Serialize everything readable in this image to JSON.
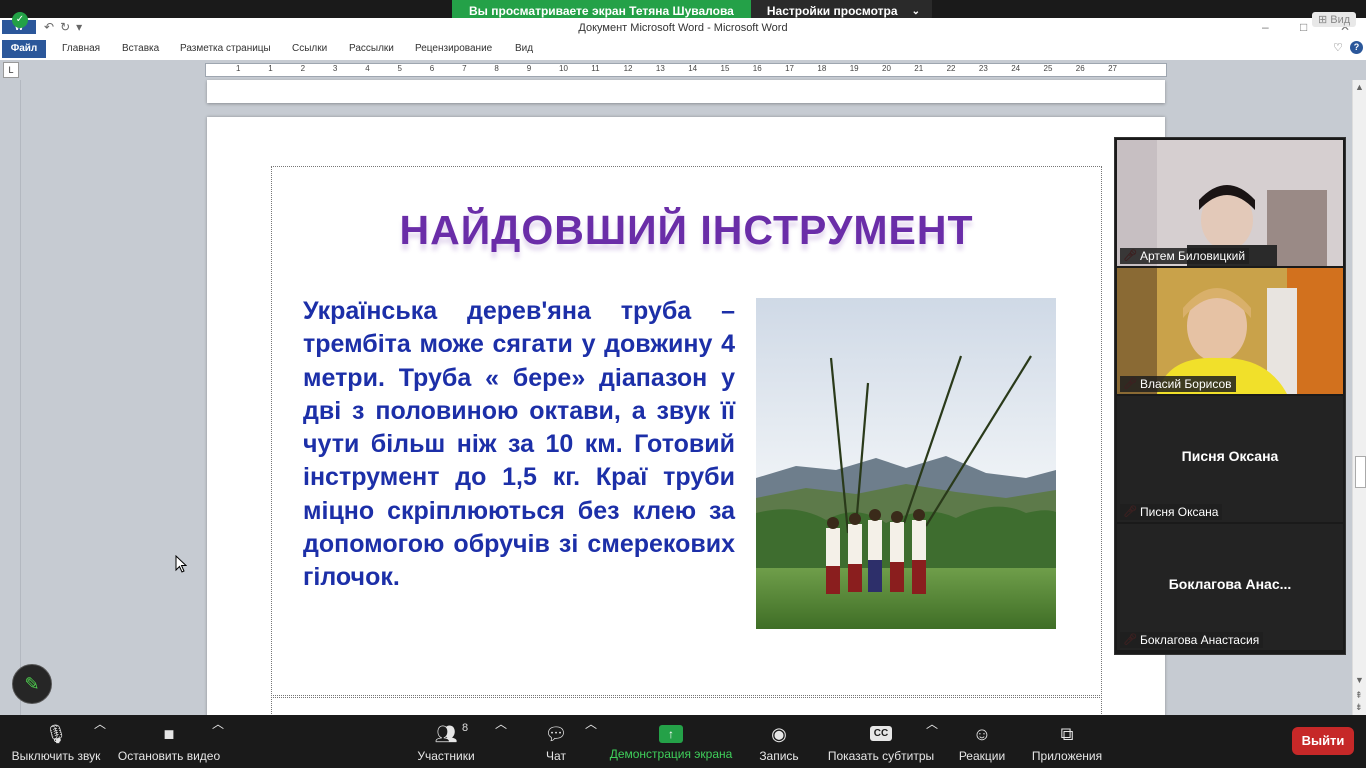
{
  "zoom": {
    "banner": {
      "sharing_text": "Вы просматриваете экран Тетяна Шувалова",
      "view_options": "Настройки просмотра"
    },
    "view_button": "Вид",
    "participants": [
      {
        "label": "Артем Биловицкий",
        "video": true
      },
      {
        "label": "Власий Борисов",
        "video": true
      },
      {
        "center_name": "Писня Оксана",
        "label": "Писня Оксана",
        "video": false
      },
      {
        "center_name": "Боклагова  Анас...",
        "label": "Боклагова Анастасия",
        "video": false
      }
    ],
    "toolbar": {
      "mute": "Выключить звук",
      "stop_video": "Остановить видео",
      "participants": "Участники",
      "participants_count": "8",
      "chat": "Чат",
      "share_screen": "Демонстрация экрана",
      "record": "Запись",
      "captions": "Показать субтитры",
      "cc": "CC",
      "reactions": "Реакции",
      "apps": "Приложения",
      "leave": "Выйти"
    }
  },
  "word": {
    "logo": "W",
    "window_title": "Документ Microsoft Word  -  Microsoft Word",
    "ribbon_tabs": [
      "Файл",
      "Главная",
      "Вставка",
      "Разметка страницы",
      "Ссылки",
      "Рассылки",
      "Рецензирование",
      "Вид"
    ],
    "ruler_marker": "L",
    "ruler_numbers": [
      "1",
      "1",
      "2",
      "3",
      "4",
      "5",
      "6",
      "7",
      "8",
      "9",
      "10",
      "11",
      "12",
      "13",
      "14",
      "15",
      "16",
      "17",
      "18",
      "19",
      "20",
      "21",
      "22",
      "23",
      "24",
      "25",
      "26",
      "27"
    ]
  },
  "slide": {
    "title": "НАЙДОВШИЙ ІНСТРУМЕНТ",
    "body": "Українська дерев'яна труба – трембіта може сягати у довжину 4 метри. Труба « бере» діапазон у дві з половиною октави, а звук її чути більш ніж за 10 км. Готовий інструмент до 1,5 кг. Краї труби міцно скріплюються без клею за допомогою обручів зі смерекових гілочок."
  },
  "icons": [
    "shield-icon",
    "undo-icon",
    "redo-icon",
    "help-icon",
    "microphone-icon",
    "camera-icon",
    "participants-icon",
    "chat-icon",
    "share-screen-icon",
    "record-icon",
    "reactions-icon",
    "apps-icon",
    "pencil-icon",
    "mic-muted-icon",
    "cursor-icon"
  ]
}
